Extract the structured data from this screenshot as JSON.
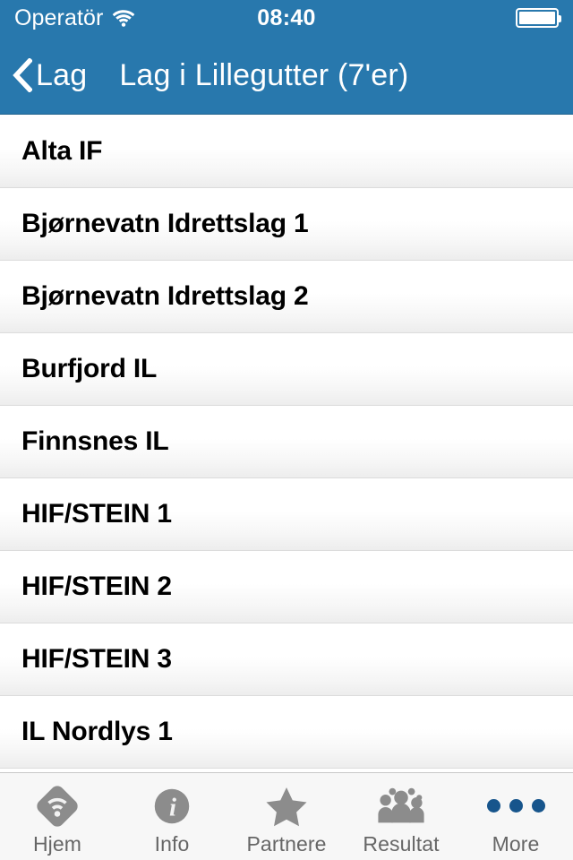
{
  "status_bar": {
    "carrier": "Operatör",
    "wifi_icon": "wifi-icon",
    "time": "08:40",
    "battery_icon": "battery-full-icon",
    "battery_level_percent": 100,
    "background_color": "#2878ad",
    "text_color": "#ffffff"
  },
  "nav_bar": {
    "back_icon": "chevron-left-icon",
    "back_label": "Lag",
    "title": "Lag i Lillegutter (7'er)",
    "background_color": "#2878ad",
    "text_color": "#ffffff"
  },
  "list": {
    "items": [
      {
        "label": "Alta IF"
      },
      {
        "label": "Bjørnevatn Idrettslag 1"
      },
      {
        "label": "Bjørnevatn Idrettslag 2"
      },
      {
        "label": "Burfjord IL"
      },
      {
        "label": "Finnsnes IL"
      },
      {
        "label": "HIF/STEIN 1"
      },
      {
        "label": "HIF/STEIN 2"
      },
      {
        "label": "HIF/STEIN 3"
      },
      {
        "label": "IL Nordlys 1"
      }
    ]
  },
  "tab_bar": {
    "background_color": "#f7f7f7",
    "label_color": "#666666",
    "icon_color": "#8c8c8c",
    "accent_color": "#17558c",
    "items": [
      {
        "label": "Hjem",
        "icon": "wifi-diamond-icon",
        "active": false
      },
      {
        "label": "Info",
        "icon": "info-circle-icon",
        "active": false
      },
      {
        "label": "Partnere",
        "icon": "star-icon",
        "active": false
      },
      {
        "label": "Resultat",
        "icon": "people-group-icon",
        "active": false
      },
      {
        "label": "More",
        "icon": "three-dots-icon",
        "active": true
      }
    ]
  }
}
